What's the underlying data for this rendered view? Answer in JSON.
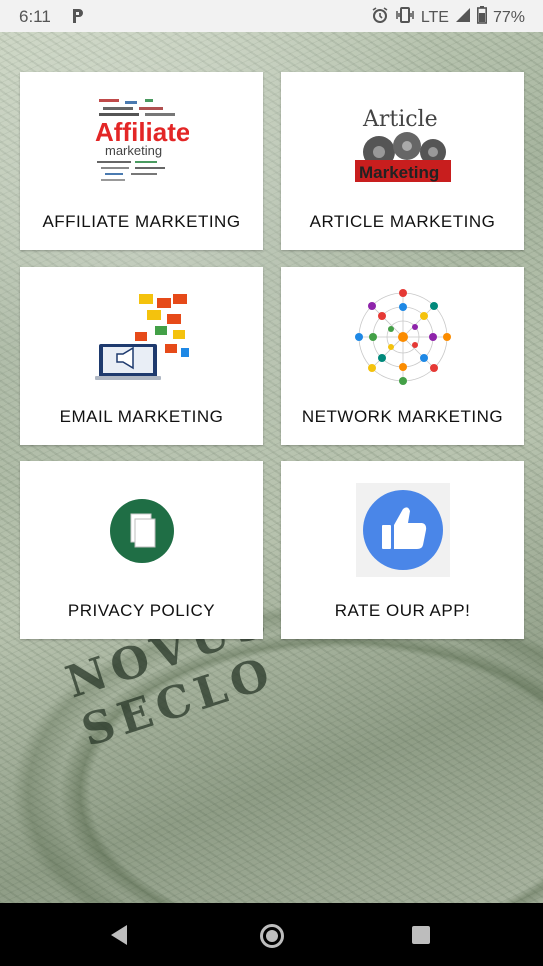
{
  "status_bar": {
    "time": "6:11",
    "app_icon": "p-icon",
    "network": "LTE",
    "battery": "77%",
    "icons": [
      "alarm-icon",
      "vibrate-icon",
      "signal-icon",
      "battery-icon"
    ]
  },
  "tiles": [
    {
      "label": "AFFILIATE MARKETING",
      "image_text_1": "Affiliate",
      "image_text_2": "marketing"
    },
    {
      "label": "ARTICLE MARKETING",
      "image_text_1": "Article",
      "image_text_2": "Marketing"
    },
    {
      "label": "EMAIL MARKETING"
    },
    {
      "label": "NETWORK MARKETING"
    },
    {
      "label": "PRIVACY POLICY"
    },
    {
      "label": "RATE OUR APP!"
    }
  ],
  "background": {
    "motto": "NOVUS ORDO SECLO"
  },
  "nav": {
    "items": [
      "back-icon",
      "home-icon",
      "recent-apps-icon"
    ]
  },
  "colors": {
    "tile_bg": "#ffffff",
    "privacy_green": "#1f6e45",
    "thumb_blue": "#4a86e8",
    "affiliate_red": "#e32626"
  }
}
